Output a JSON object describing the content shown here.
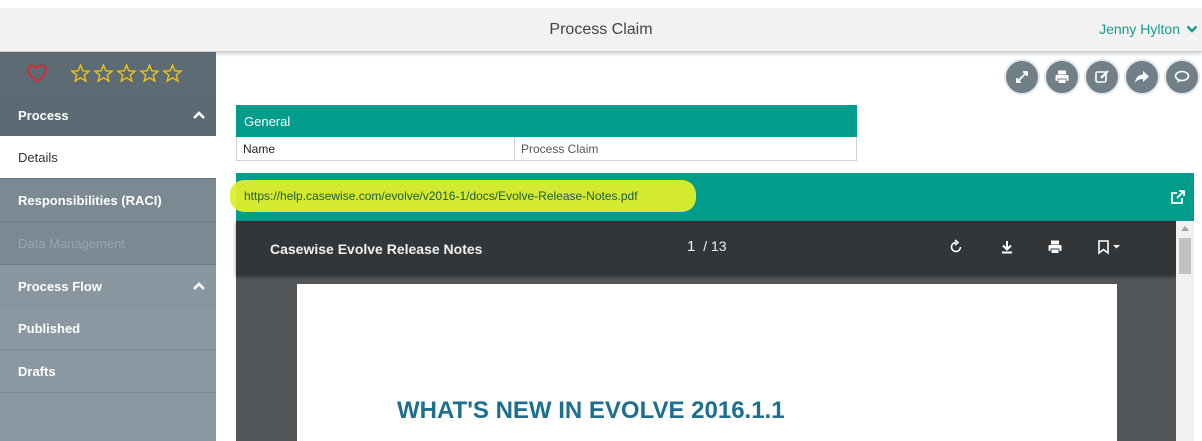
{
  "header": {
    "title": "Process Claim",
    "user": "Jenny Hylton"
  },
  "sidebar": {
    "rating": {
      "favorite_icon": "heart-icon",
      "stars": 5
    },
    "sections": [
      {
        "label": "Process",
        "items": [
          "Details",
          "Responsibilities (RACI)",
          "Data Management"
        ]
      },
      {
        "label": "Process Flow",
        "items": [
          "Published",
          "Drafts"
        ]
      }
    ]
  },
  "actions": [
    "expand-icon",
    "print-icon",
    "edit-icon",
    "share-icon",
    "comment-icon"
  ],
  "general": {
    "title": "General",
    "row": {
      "key": "Name",
      "value": "Process Claim"
    }
  },
  "document": {
    "url": "https://help.casewise.com/evolve/v2016-1/docs/Evolve-Release-Notes.pdf",
    "title": "Casewise Evolve Release Notes",
    "page_current": "1",
    "page_total": "/ 13",
    "heading": "WHAT'S NEW IN EVOLVE 2016.1.1"
  },
  "colors": {
    "accent": "#009c8c",
    "sidebar": "#6f7f89",
    "highlight": "#dfee2c",
    "link": "#1a9a8a"
  }
}
